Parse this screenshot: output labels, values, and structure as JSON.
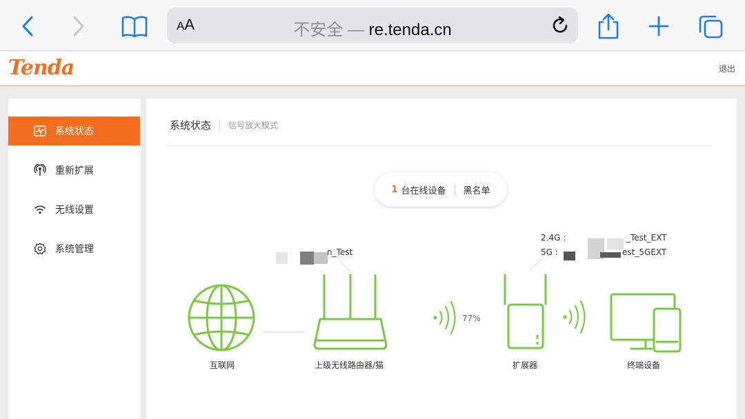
{
  "browser": {
    "reader_label_small": "A",
    "reader_label_large": "A",
    "insecure_label": "不安全 —",
    "domain": "re.tenda.cn"
  },
  "header": {
    "logo": "Tenda",
    "logout": "退出"
  },
  "sidebar": {
    "items": [
      {
        "label": "系统状态",
        "icon": "activity-icon",
        "active": true
      },
      {
        "label": "重新扩展",
        "icon": "signal-icon",
        "active": false
      },
      {
        "label": "无线设置",
        "icon": "wifi-icon",
        "active": false
      },
      {
        "label": "系统管理",
        "icon": "gear-icon",
        "active": false
      }
    ]
  },
  "main": {
    "tab_title": "系统状态",
    "mode_label": "信号放大模式",
    "online_count": "1",
    "online_label": "台在线设备",
    "blacklist_label": "黑名单"
  },
  "topology": {
    "upstream_ssid_suffix": "n_Test",
    "signal_strength": "77%",
    "ext_24g_label": "2.4G :",
    "ext_24g_ssid_suffix": "_Test_EXT",
    "ext_5g_label": "5G :",
    "ext_5g_ssid_suffix": "est_5GEXT",
    "nodes": {
      "internet": "互联网",
      "router": "上级无线路由器/猫",
      "extender": "扩展器",
      "terminal": "终端设备"
    }
  },
  "colors": {
    "accent": "#f26f21",
    "device_green": "#7ac943",
    "ios_blue": "#1a7cf5"
  }
}
